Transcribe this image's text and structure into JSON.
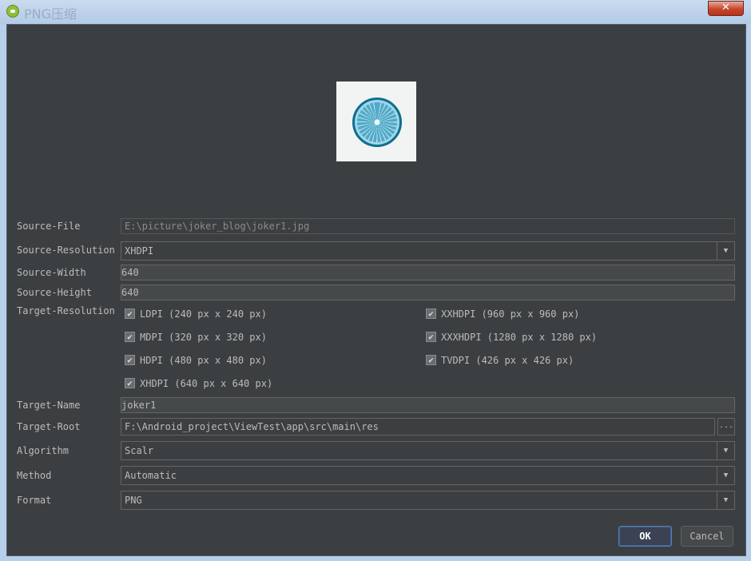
{
  "window": {
    "title": "PNG压缩",
    "close_label": "✕"
  },
  "form": {
    "source_file": {
      "label": "Source-File",
      "value": "E:\\picture\\joker_blog\\joker1.jpg"
    },
    "source_resolution": {
      "label": "Source-Resolution",
      "value": "XHDPI"
    },
    "source_width": {
      "label": "Source-Width",
      "value": "640"
    },
    "source_height": {
      "label": "Source-Height",
      "value": "640"
    },
    "target_resolution": {
      "label": "Target-Resolution",
      "options": [
        {
          "label": "LDPI (240 px x 240 px)",
          "checked": true
        },
        {
          "label": "MDPI (320 px x 320 px)",
          "checked": true
        },
        {
          "label": "HDPI (480 px x 480 px)",
          "checked": true
        },
        {
          "label": "XHDPI (640 px x 640 px)",
          "checked": true
        },
        {
          "label": "XXHDPI (960 px x 960 px)",
          "checked": true
        },
        {
          "label": "XXXHDPI (1280 px x 1280 px)",
          "checked": true
        },
        {
          "label": "TVDPI (426 px x 426 px)",
          "checked": true
        }
      ]
    },
    "target_name": {
      "label": "Target-Name",
      "value": "joker1"
    },
    "target_root": {
      "label": "Target-Root",
      "value": "F:\\Android_project\\ViewTest\\app\\src\\main\\res",
      "browse_label": "..."
    },
    "algorithm": {
      "label": "Algorithm",
      "value": "Scalr"
    },
    "method": {
      "label": "Method",
      "value": "Automatic"
    },
    "format": {
      "label": "Format",
      "value": "PNG"
    }
  },
  "buttons": {
    "ok": "OK",
    "cancel": "Cancel"
  },
  "icons": {
    "check": "✔",
    "dropdown": "▼"
  },
  "colors": {
    "panel_bg": "#3c3f41",
    "text": "#bbbbbb",
    "ok_border": "#5c7ab0"
  }
}
